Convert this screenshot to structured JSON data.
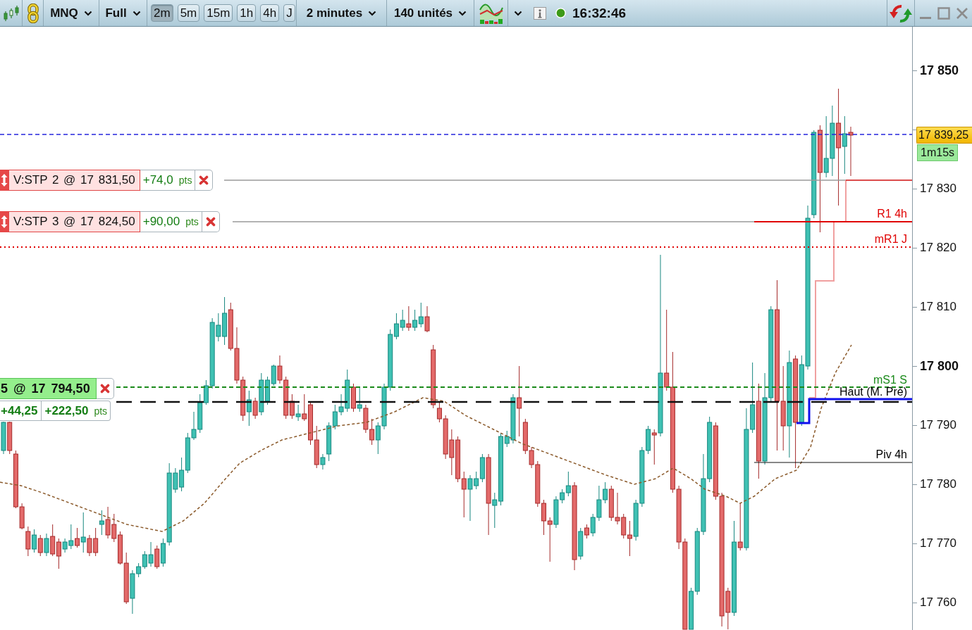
{
  "toolbar": {
    "instrument": "MNQ",
    "layout": "Full",
    "timeframes": [
      {
        "label": "2m",
        "selected": true
      },
      {
        "label": "5m",
        "selected": false
      },
      {
        "label": "15m",
        "selected": false
      },
      {
        "label": "1h",
        "selected": false
      },
      {
        "label": "4h",
        "selected": false
      },
      {
        "label": "J",
        "selected": false
      }
    ],
    "period": "2 minutes",
    "bar_count": "140 unités",
    "connected": true,
    "clock": "16:32:46"
  },
  "chart": {
    "orders": [
      {
        "label": "V:STP 2 @ 17 831,50",
        "profit": "+74,0",
        "unit": "pts"
      },
      {
        "label": "V:STP 3 @ 17 824,50",
        "profit": "+90,00",
        "unit": "pts"
      }
    ],
    "position": {
      "label": "5 @ 17 794,50",
      "profit": "+44,25",
      "total_profit": "+222,50",
      "unit": "pts"
    },
    "levels": [
      {
        "label": "R1 4h",
        "color": "#e00000"
      },
      {
        "label": "mR1 J",
        "color": "#e00000"
      },
      {
        "label": "mS1 S",
        "color": "#1a8a1a"
      },
      {
        "label": "Haut (M. Pré)",
        "color": "#000000"
      },
      {
        "label": "Piv 4h",
        "color": "#000000"
      }
    ],
    "price_axis": {
      "ticks": [
        {
          "label": "17 850",
          "major": true
        },
        {
          "label": "17 830",
          "major": false
        },
        {
          "label": "17 820",
          "major": false
        },
        {
          "label": "17 810",
          "major": false
        },
        {
          "label": "17 800",
          "major": true
        },
        {
          "label": "17 790",
          "major": false
        },
        {
          "label": "17 780",
          "major": false
        },
        {
          "label": "17 770",
          "major": false
        },
        {
          "label": "17 760",
          "major": false
        }
      ],
      "last_price": "17 839,25",
      "countdown": "1m15s"
    }
  }
}
